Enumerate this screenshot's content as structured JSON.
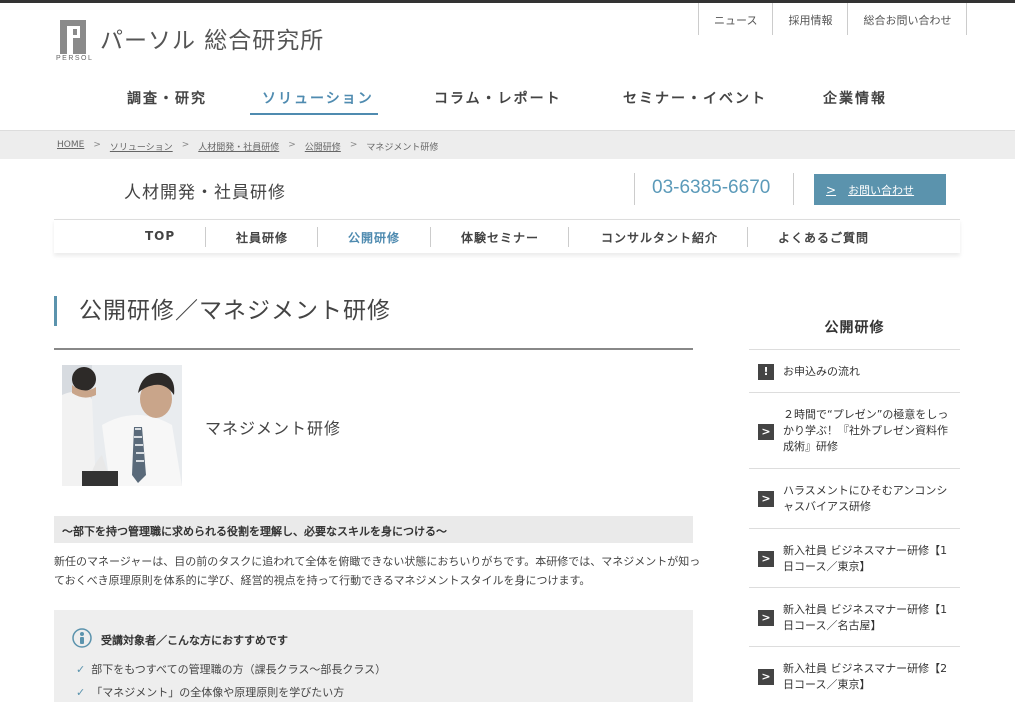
{
  "header": {
    "logo_text": "パーソル 総合研究所",
    "logo_sub": "PERSOL",
    "util_nav": [
      "ニュース",
      "採用情報",
      "総合お問い合わせ"
    ],
    "global_nav": [
      {
        "label": "調査・研究",
        "active": false
      },
      {
        "label": "ソリューション",
        "active": true
      },
      {
        "label": "コラム・レポート",
        "active": false
      },
      {
        "label": "セミナー・イベント",
        "active": false
      },
      {
        "label": "企業情報",
        "active": false
      }
    ]
  },
  "breadcrumb": [
    "HOME",
    "ソリューション",
    "人材開発・社員研修",
    "公開研修",
    "マネジメント研修"
  ],
  "section": {
    "title": "人材開発・社員研修",
    "phone": "03-6385-6670",
    "contact_label": "お問い合わせ"
  },
  "local_nav": [
    {
      "label": "TOP",
      "active": false
    },
    {
      "label": "社員研修",
      "active": false
    },
    {
      "label": "公開研修",
      "active": true
    },
    {
      "label": "体験セミナー",
      "active": false
    },
    {
      "label": "コンサルタント紹介",
      "active": false
    },
    {
      "label": "よくあるご質問",
      "active": false
    }
  ],
  "main": {
    "heading": "公開研修／マネジメント研修",
    "course_name": "マネジメント研修",
    "lead": "〜部下を持つ管理職に求められる役割を理解し、必要なスキルを身につける〜",
    "description": "新任のマネージャーは、目の前のタスクに追われて全体を俯瞰できない状態におちいりがちです。本研修では、マネジメントが知っておくべき原理原則を体系的に学び、経営的視点を持って行動できるマネジメントスタイルを身につけます。",
    "target_title": "受講対象者／こんな方におすすめです",
    "target_items": [
      "部下をもつすべての管理職の方（課長クラス〜部長クラス）",
      "「マネジメント」の全体像や原理原則を学びたい方"
    ]
  },
  "sidebar": {
    "title": "公開研修",
    "items": [
      {
        "label": "お申込みの流れ",
        "icon": "exclamation-icon"
      },
      {
        "label": "２時間で“プレゼン”の極意をしっかり学ぶ！『社外プレゼン資料作成術』研修",
        "icon": "chevron-right-icon"
      },
      {
        "label": "ハラスメントにひそむアンコンシャスバイアス研修",
        "icon": "chevron-right-icon"
      },
      {
        "label": "新入社員 ビジネスマナー研修【1日コース／東京】",
        "icon": "chevron-right-icon"
      },
      {
        "label": "新入社員 ビジネスマナー研修【1日コース／名古屋】",
        "icon": "chevron-right-icon"
      },
      {
        "label": "新入社員 ビジネスマナー研修【2日コース／東京】",
        "icon": "chevron-right-icon"
      }
    ]
  },
  "colors": {
    "accent": "#5b93ad",
    "nav_active": "#4f8bb0",
    "phone": "#5b9ab9"
  }
}
